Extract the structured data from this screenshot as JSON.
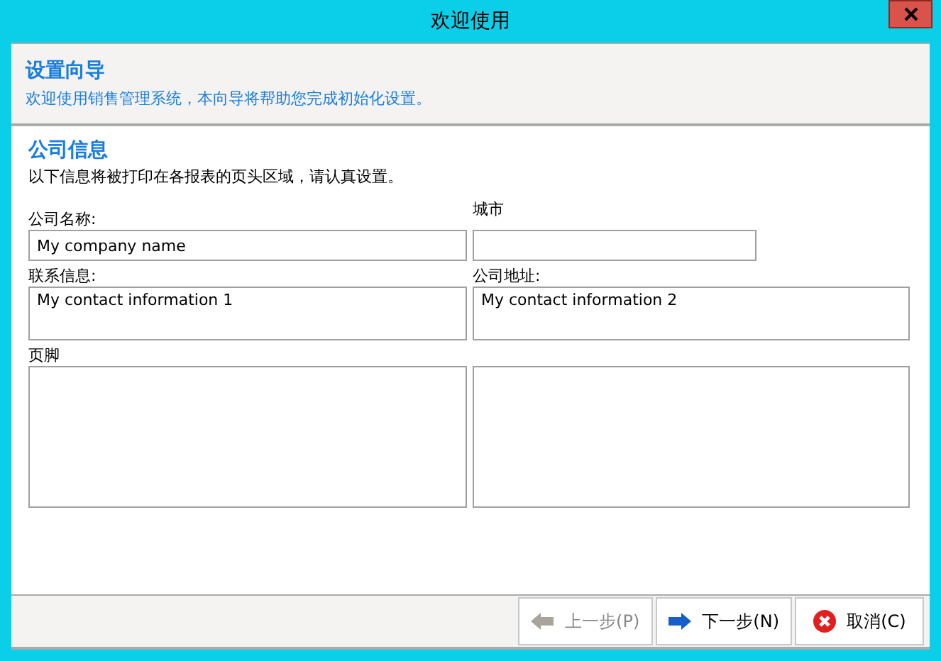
{
  "window": {
    "title": "欢迎使用"
  },
  "header": {
    "title": "设置向导",
    "subtitle": "欢迎使用销售管理系统，本向导将帮助您完成初始化设置。"
  },
  "section": {
    "title": "公司信息",
    "description": "以下信息将被打印在各报表的页头区域，请认真设置。"
  },
  "fields": {
    "company_name": {
      "label": "公司名称:",
      "value": "My company name"
    },
    "city": {
      "label": "城市"
    },
    "contact": {
      "label": "联系信息:",
      "value": "My contact information 1"
    },
    "address": {
      "label": "公司地址:",
      "value": "My contact information 2"
    },
    "footer": {
      "label": "页脚"
    }
  },
  "buttons": [
    {
      "label": "上一步(P)",
      "kind": "back",
      "disabled": true
    },
    {
      "label": "下一步(N)",
      "kind": "next",
      "disabled": false
    },
    {
      "label": "取消(C)",
      "kind": "cancel",
      "disabled": false
    }
  ]
}
